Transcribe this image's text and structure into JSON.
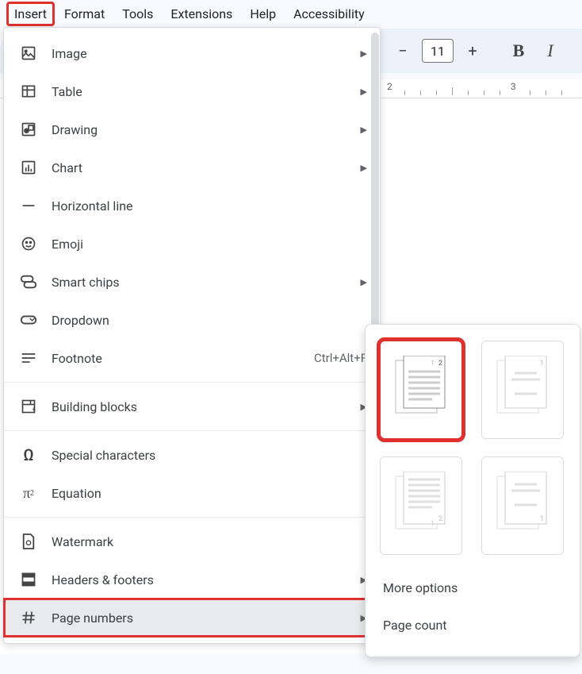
{
  "menubar": {
    "items": [
      "Insert",
      "Format",
      "Tools",
      "Extensions",
      "Help",
      "Accessibility"
    ],
    "activeIndex": 0
  },
  "toolbar": {
    "fontSize": "11"
  },
  "ruler": {
    "marks": [
      "2",
      "3"
    ]
  },
  "insertMenu": {
    "items": [
      {
        "label": "Image",
        "icon": "image",
        "submenu": true
      },
      {
        "label": "Table",
        "icon": "table",
        "submenu": true
      },
      {
        "label": "Drawing",
        "icon": "drawing",
        "submenu": true
      },
      {
        "label": "Chart",
        "icon": "chart",
        "submenu": true
      },
      {
        "label": "Horizontal line",
        "icon": "hr"
      },
      {
        "label": "Emoji",
        "icon": "emoji"
      },
      {
        "label": "Smart chips",
        "icon": "chips",
        "submenu": true
      },
      {
        "label": "Dropdown",
        "icon": "dropdown"
      },
      {
        "label": "Footnote",
        "icon": "footnote",
        "shortcut": "Ctrl+Alt+F"
      },
      {
        "divider": true
      },
      {
        "label": "Building blocks",
        "icon": "blocks",
        "submenu": true
      },
      {
        "divider": true
      },
      {
        "label": "Special characters",
        "icon": "omega"
      },
      {
        "label": "Equation",
        "icon": "pi"
      },
      {
        "divider": true
      },
      {
        "label": "Watermark",
        "icon": "watermark"
      },
      {
        "label": "Headers & footers",
        "icon": "headers",
        "submenu": true
      },
      {
        "label": "Page numbers",
        "icon": "hash",
        "submenu": true,
        "highlighted": true,
        "annotated": true
      }
    ]
  },
  "pageNumbersSubmenu": {
    "moreOptions": "More options",
    "pageCount": "Page count"
  }
}
